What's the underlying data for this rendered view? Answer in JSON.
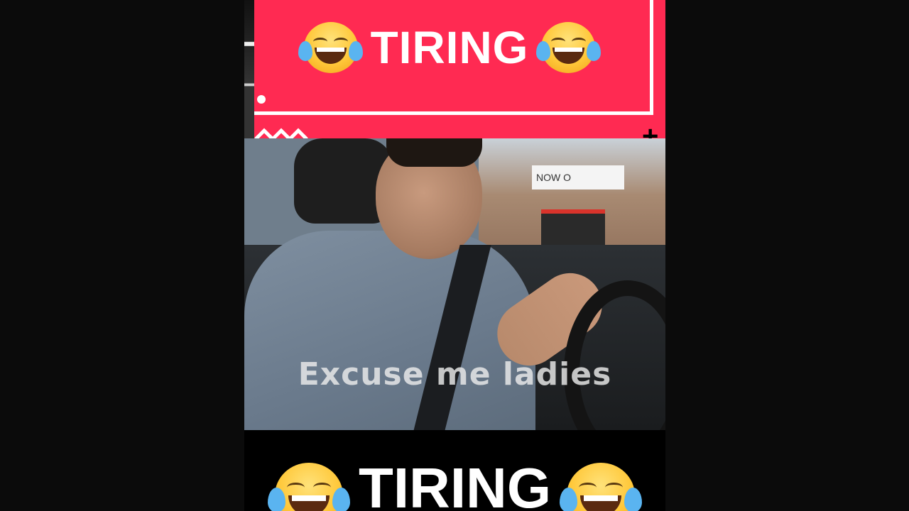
{
  "banner": {
    "left_emoji": "tears-of-joy-emoji",
    "title": "TIRING",
    "right_emoji": "tears-of-joy-emoji",
    "background_color": "#ff2a52"
  },
  "video": {
    "store_sign": "NOW O",
    "caption": "Excuse me ladies"
  },
  "bottom": {
    "left_emoji": "tears-of-joy-emoji",
    "title": "TIRING",
    "right_emoji": "tears-of-joy-emoji"
  }
}
